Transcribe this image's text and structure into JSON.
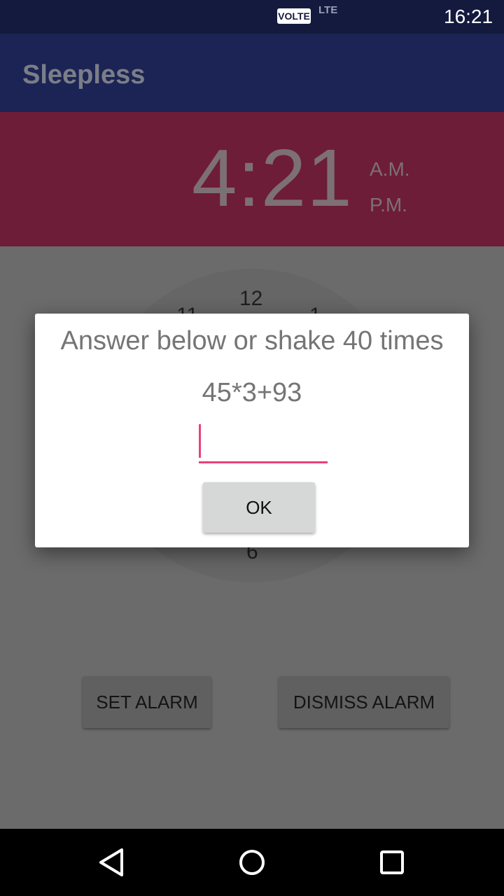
{
  "status_bar": {
    "volte_label": "VOLTE",
    "lte_label": "LTE",
    "time": "16:21",
    "icons": [
      "gallery-icon",
      "nfc-icon",
      "signal-icon",
      "signal-icon",
      "battery-icon"
    ]
  },
  "app_bar": {
    "title": "Sleepless"
  },
  "time_header": {
    "time": "4:21",
    "am_label": "A.M.",
    "pm_label": "P.M."
  },
  "clock": {
    "num_12": "12",
    "num_11": "11",
    "num_1": "1",
    "num_6": "6"
  },
  "dialog": {
    "title": "Answer below or shake 40 times",
    "question": "45*3+93",
    "answer_value": "",
    "ok_label": "OK"
  },
  "buttons": {
    "set_alarm": "SET ALARM",
    "dismiss_alarm": "DISMISS ALARM"
  },
  "nav_bar": {
    "icons": [
      "back-icon",
      "home-icon",
      "recents-icon"
    ]
  },
  "colors": {
    "status_bar": "#141a3e",
    "app_bar": "#1b2454",
    "time_header": "#6d1d38",
    "accent": "#ec407a"
  }
}
